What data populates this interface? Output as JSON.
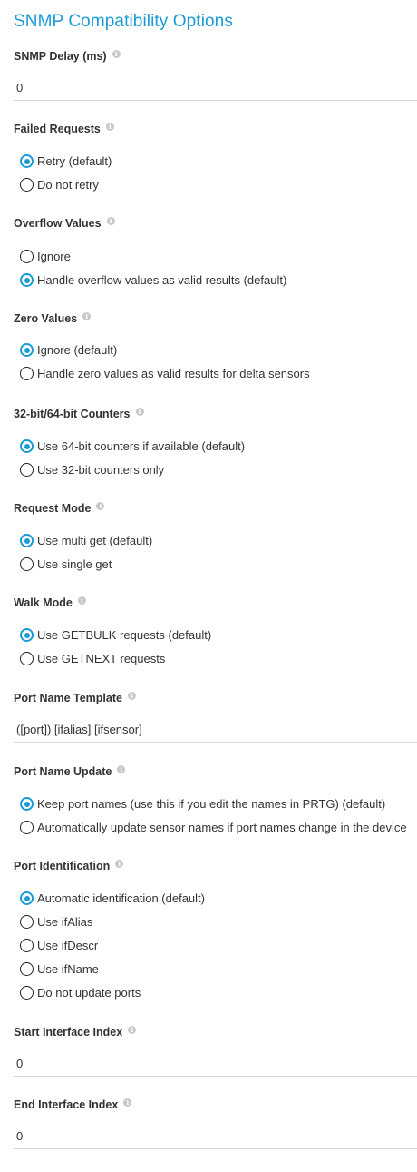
{
  "title": "SNMP Compatibility Options",
  "info_glyph": "i",
  "snmp_delay": {
    "label": "SNMP Delay (ms)",
    "value": "0"
  },
  "failed_requests": {
    "label": "Failed Requests",
    "options": [
      "Retry (default)",
      "Do not retry"
    ],
    "selected": 0
  },
  "overflow_values": {
    "label": "Overflow Values",
    "options": [
      "Ignore",
      "Handle overflow values as valid results (default)"
    ],
    "selected": 1
  },
  "zero_values": {
    "label": "Zero Values",
    "options": [
      "Ignore (default)",
      "Handle zero values as valid results for delta sensors"
    ],
    "selected": 0
  },
  "counters": {
    "label": "32-bit/64-bit Counters",
    "options": [
      "Use 64-bit counters if available (default)",
      "Use 32-bit counters only"
    ],
    "selected": 0
  },
  "request_mode": {
    "label": "Request Mode",
    "options": [
      "Use multi get (default)",
      "Use single get"
    ],
    "selected": 0
  },
  "walk_mode": {
    "label": "Walk Mode",
    "options": [
      "Use GETBULK requests (default)",
      "Use GETNEXT requests"
    ],
    "selected": 0
  },
  "port_name_template": {
    "label": "Port Name Template",
    "value": "([port]) [ifalias] [ifsensor]"
  },
  "port_name_update": {
    "label": "Port Name Update",
    "options": [
      "Keep port names (use this if you edit the names in PRTG) (default)",
      "Automatically update sensor names if port names change in the device"
    ],
    "selected": 0
  },
  "port_identification": {
    "label": "Port Identification",
    "options": [
      "Automatic identification (default)",
      "Use ifAlias",
      "Use ifDescr",
      "Use ifName",
      "Do not update ports"
    ],
    "selected": 0
  },
  "start_interface_index": {
    "label": "Start Interface Index",
    "value": "0"
  },
  "end_interface_index": {
    "label": "End Interface Index",
    "value": "0"
  },
  "colors": {
    "accent": "#1a9bd7",
    "text": "#333333",
    "divider": "#d6d6d6"
  }
}
